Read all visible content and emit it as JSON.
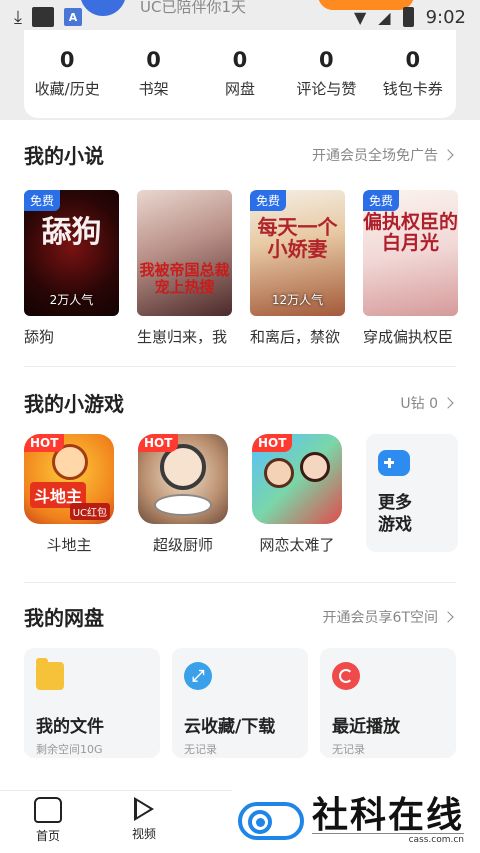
{
  "status_bar": {
    "time": "9:02"
  },
  "header": {
    "uc_text": "UC已陪伴你1天",
    "stats": [
      {
        "value": "0",
        "label": "收藏/历史"
      },
      {
        "value": "0",
        "label": "书架"
      },
      {
        "value": "0",
        "label": "网盘"
      },
      {
        "value": "0",
        "label": "评论与赞"
      },
      {
        "value": "0",
        "label": "钱包卡券"
      }
    ]
  },
  "novels_section": {
    "title": "我的小说",
    "link": "开通会员全场免广告",
    "items": [
      {
        "badge": "免费",
        "cover_text": "舔狗",
        "popularity": "2万人气",
        "name": "舔狗"
      },
      {
        "badge": "",
        "cover_text": "我被帝国总裁宠上热搜",
        "popularity": "",
        "name": "生崽归来，我"
      },
      {
        "badge": "免费",
        "cover_text": "每天一个小娇妻",
        "popularity": "12万人气",
        "name": "和离后，禁欲"
      },
      {
        "badge": "免费",
        "cover_text": "偏执权臣的白月光",
        "popularity": "",
        "name": "穿成偏执权臣"
      }
    ]
  },
  "games_section": {
    "title": "我的小游戏",
    "link": "U钻 0",
    "items": [
      {
        "badge": "HOT",
        "name": "斗地主",
        "icon_text": "斗地主",
        "icon_sub": "UC红包"
      },
      {
        "badge": "HOT",
        "name": "超级厨师"
      },
      {
        "badge": "HOT",
        "name": "网恋太难了"
      }
    ],
    "more_label": "更多游戏"
  },
  "disk_section": {
    "title": "我的网盘",
    "link": "开通会员享6T空间",
    "cards": [
      {
        "icon": "folder-icon",
        "title": "我的文件",
        "sub": "剩余空间10G"
      },
      {
        "icon": "cloud-collect-icon",
        "title": "云收藏/下载",
        "sub": "无记录"
      },
      {
        "icon": "recent-play-icon",
        "title": "最近播放",
        "sub": "无记录"
      }
    ]
  },
  "bottom_nav": {
    "home": "首页",
    "video": "视频"
  },
  "watermark": {
    "title": "社科在线",
    "url": "cass.com.cn"
  },
  "colors": {
    "accent_blue": "#2b6fe8",
    "hot_red": "#ff3b30",
    "orange": "#ff8a1f"
  }
}
